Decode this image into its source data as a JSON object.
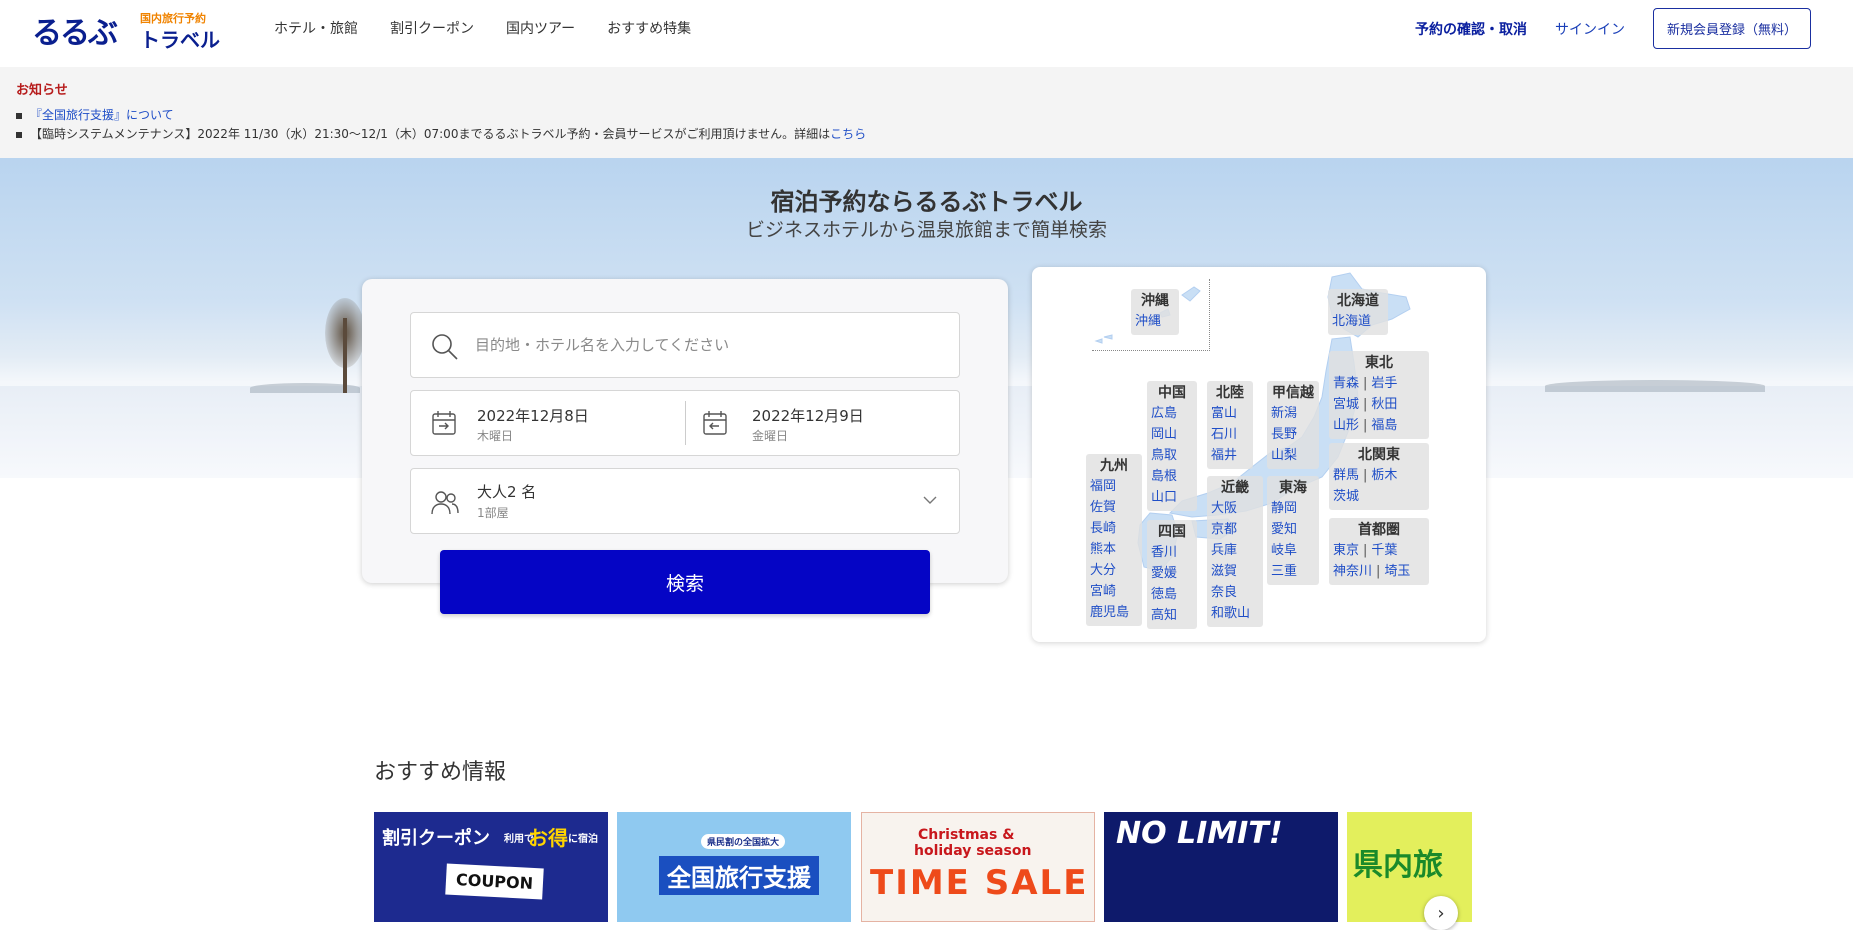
{
  "header": {
    "logo_main": "るるぶ",
    "logo_sub": "国内旅行予約",
    "logo_travel": "トラベル",
    "nav": [
      "ホテル・旅館",
      "割引クーポン",
      "国内ツアー",
      "おすすめ特集"
    ],
    "confirm": "予約の確認・取消",
    "signin": "サインイン",
    "register": "新規会員登録（無料）"
  },
  "notice": {
    "title": "お知らせ",
    "item1_link": "『全国旅行支援』について",
    "item2_text": "【臨時システムメンテナンス】2022年 11/30（水）21:30～12/1（木）07:00までるるぶトラベル予約・会員サービスがご利用頂けません。詳細は",
    "item2_link": "こちら"
  },
  "hero": {
    "title": "宿泊予約ならるるぶトラベル",
    "subtitle": "ビジネスホテルから温泉旅館まで簡単検索"
  },
  "search": {
    "dest_placeholder": "目的地・ホテル名を入力してください",
    "checkin_date": "2022年12月8日",
    "checkin_day": "木曜日",
    "checkout_date": "2022年12月9日",
    "checkout_day": "金曜日",
    "guests": "大人2 名",
    "rooms": "1部屋",
    "button": "検索"
  },
  "map": {
    "okinawa": {
      "name": "沖縄",
      "prefs": [
        "沖縄"
      ]
    },
    "hokkaido": {
      "name": "北海道",
      "prefs": [
        "北海道"
      ]
    },
    "tohoku": {
      "name": "東北",
      "rows": [
        [
          "青森",
          "岩手"
        ],
        [
          "宮城",
          "秋田"
        ],
        [
          "山形",
          "福島"
        ]
      ]
    },
    "chugoku": {
      "name": "中国",
      "prefs": [
        "広島",
        "岡山",
        "鳥取",
        "島根",
        "山口"
      ]
    },
    "hokuriku": {
      "name": "北陸",
      "prefs": [
        "富山",
        "石川",
        "福井"
      ]
    },
    "koshinetsu": {
      "name": "甲信越",
      "prefs": [
        "新潟",
        "長野",
        "山梨"
      ]
    },
    "kitakanto": {
      "name": "北関東",
      "rows": [
        [
          "群馬",
          "栃木"
        ],
        [
          "茨城"
        ]
      ]
    },
    "kyushu": {
      "name": "九州",
      "prefs": [
        "福岡",
        "佐賀",
        "長崎",
        "熊本",
        "大分",
        "宮崎",
        "鹿児島"
      ]
    },
    "kinki": {
      "name": "近畿",
      "prefs": [
        "大阪",
        "京都",
        "兵庫",
        "滋賀",
        "奈良",
        "和歌山"
      ]
    },
    "tokai": {
      "name": "東海",
      "prefs": [
        "静岡",
        "愛知",
        "岐阜",
        "三重"
      ]
    },
    "shikoku": {
      "name": "四国",
      "prefs": [
        "香川",
        "愛媛",
        "徳島",
        "高知"
      ]
    },
    "shutoken": {
      "name": "首都圏",
      "rows": [
        [
          "東京",
          "千葉"
        ],
        [
          "神奈川",
          "埼玉"
        ]
      ]
    }
  },
  "recommended": {
    "title": "おすすめ情報",
    "banners": [
      {
        "line1": "割引クーポン",
        "line1b": "利用で",
        "line1c": "お得",
        "line1d": "に宿泊",
        "tag": "COUPON"
      },
      {
        "small": "県民割の全国拡大",
        "main": "全国旅行支援"
      },
      {
        "line1": "Christmas &",
        "line2": "holiday season",
        "main": "TIME SALE"
      },
      {
        "main": "NO LIMIT!"
      },
      {
        "main": "県内旅"
      }
    ]
  }
}
